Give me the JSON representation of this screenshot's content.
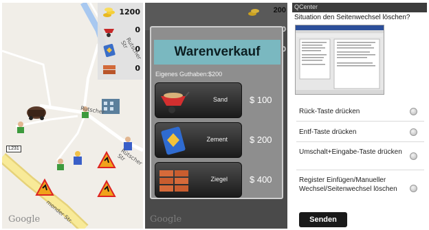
{
  "map_panel": {
    "resources": [
      {
        "icon": "gold-coins-icon",
        "value": "1200"
      },
      {
        "icon": "wheelbarrow-icon",
        "value": "0"
      },
      {
        "icon": "cement-bag-icon",
        "value": "0"
      },
      {
        "icon": "brick-icon",
        "value": "0"
      }
    ],
    "streets": [
      "Rutscher Str",
      "Rütscher Str",
      "Rutscher",
      "Rütscher Str",
      "monder Str.",
      "monder Str."
    ],
    "road_shield": "L231",
    "attribution": "Google"
  },
  "shop_panel": {
    "resources": [
      {
        "icon": "gold-coins-icon",
        "value": "200"
      },
      {
        "icon": "wheelbarrow-icon",
        "value": "0"
      },
      {
        "icon": "cement-bag-icon",
        "value": "0"
      }
    ],
    "dialog_title": "Warenverkauf",
    "balance_label": "Eigenes Guthaben:$200",
    "items": [
      {
        "name": "Sand",
        "price": "$ 100",
        "icon": "wheelbarrow-sand-icon"
      },
      {
        "name": "Zement",
        "price": "$ 200",
        "icon": "cement-bag-icon"
      },
      {
        "name": "Ziegel",
        "price": "$ 400",
        "icon": "bricks-icon"
      }
    ],
    "attribution": "Google"
  },
  "qcenter_panel": {
    "app_title": "QCenter",
    "question": "Situation den Seitenwechsel löschen?",
    "options": [
      {
        "label": "Rück-Taste drücken"
      },
      {
        "label": "Entf-Taste drücken"
      },
      {
        "label": "Umschalt+Eingabe-Taste drücken"
      },
      {
        "label": "Register Einfügen/Manueller Wechsel/Seitenwechsel löschen"
      }
    ],
    "submit_label": "Senden"
  },
  "colors": {
    "dialog_title_bg": "#7ab8c0",
    "road_yellow": "#f5e27a",
    "water_blue": "#a8c8f0"
  }
}
